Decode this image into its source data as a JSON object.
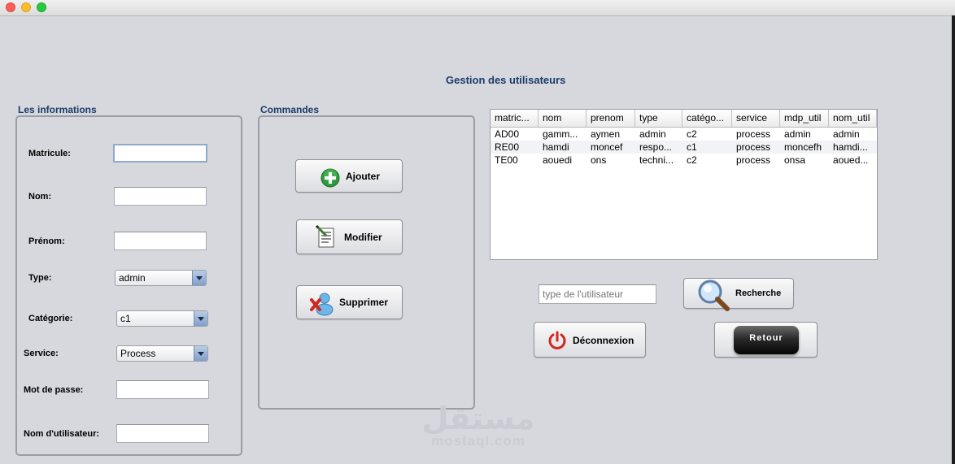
{
  "window": {
    "title": ""
  },
  "page": {
    "title": "Gestion des utilisateurs"
  },
  "info_panel": {
    "title": "Les informations",
    "matricule": {
      "label": "Matricule:",
      "value": ""
    },
    "nom": {
      "label": "Nom:",
      "value": ""
    },
    "prenom": {
      "label": "Prénom:",
      "value": ""
    },
    "type": {
      "label": "Type:",
      "selected": "admin"
    },
    "categorie": {
      "label": "Catégorie:",
      "selected": "c1"
    },
    "service": {
      "label": "Service:",
      "selected": "Process"
    },
    "mot_de_passe": {
      "label": "Mot de passe:",
      "value": ""
    },
    "nom_utilisateur": {
      "label": "Nom d'utilisateur:",
      "value": ""
    }
  },
  "commands_panel": {
    "title": "Commandes",
    "ajouter_label": "Ajouter",
    "modifier_label": "Modifier",
    "supprimer_label": "Supprimer"
  },
  "users_table": {
    "columns": [
      "matric...",
      "nom",
      "prenom",
      "type",
      "catégo...",
      "service",
      "mdp_util",
      "nom_util"
    ],
    "rows": [
      [
        "AD00",
        "gamm...",
        "aymen",
        "admin",
        "c2",
        "process",
        "admin",
        "admin"
      ],
      [
        "RE00",
        "hamdi",
        "moncef",
        "respo...",
        "c1",
        "process",
        "moncefh",
        "hamdi..."
      ],
      [
        "TE00",
        "aouedi",
        "ons",
        "techni...",
        "c2",
        "process",
        "onsa",
        "aoued..."
      ]
    ]
  },
  "search": {
    "placeholder": "type de l'utilisateur",
    "button_label": "Recherche"
  },
  "deconnexion_label": "Déconnexion",
  "retour_label": "Retour",
  "watermark": {
    "arabic": "مستقل",
    "latin": "mostaql.com"
  },
  "colors": {
    "background": "#d6d8de",
    "title": "#1b3b68",
    "accent_green": "#2f9a3e",
    "accent_red": "#d0271f"
  }
}
